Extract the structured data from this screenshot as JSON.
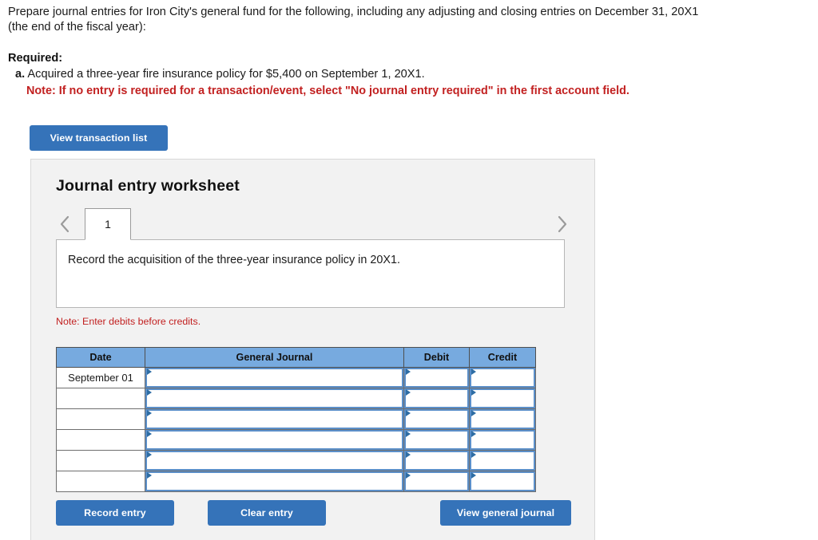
{
  "prompt": {
    "line1": "Prepare journal entries for Iron City's general fund for the following, including any adjusting and closing entries on December 31, 20X1",
    "line2": "(the end of the fiscal year):"
  },
  "required": {
    "title": "Required:",
    "item_label": "a.",
    "item_text": "Acquired a three-year fire insurance policy for $5,400 on September 1, 20X1.",
    "note": "Note: If no entry is required for a transaction/event, select \"No journal entry required\" in the first account field.",
    "note_color": "#c22121"
  },
  "toolbar": {
    "view_transaction_list": "View transaction list"
  },
  "worksheet": {
    "title": "Journal entry worksheet",
    "tabs": [
      {
        "label": "1",
        "active": true
      }
    ],
    "prev_icon": "chevron-left-icon",
    "next_icon": "chevron-right-icon",
    "description": "Record the acquisition of the three-year insurance policy in 20X1.",
    "debits_note": "Note: Enter debits before credits.",
    "table": {
      "headers": [
        "Date",
        "General Journal",
        "Debit",
        "Credit"
      ],
      "rows": [
        {
          "date": "September 01",
          "general_journal": "",
          "debit": "",
          "credit": ""
        },
        {
          "date": "",
          "general_journal": "",
          "debit": "",
          "credit": ""
        },
        {
          "date": "",
          "general_journal": "",
          "debit": "",
          "credit": ""
        },
        {
          "date": "",
          "general_journal": "",
          "debit": "",
          "credit": ""
        },
        {
          "date": "",
          "general_journal": "",
          "debit": "",
          "credit": ""
        },
        {
          "date": "",
          "general_journal": "",
          "debit": "",
          "credit": ""
        }
      ]
    },
    "buttons": {
      "record_entry": "Record entry",
      "clear_entry": "Clear entry",
      "view_general_journal": "View general journal"
    }
  },
  "colors": {
    "button_blue": "#3573b9",
    "table_header_blue": "#77aadf",
    "panel_grey": "#f2f2f2",
    "note_red": "#c22121"
  }
}
